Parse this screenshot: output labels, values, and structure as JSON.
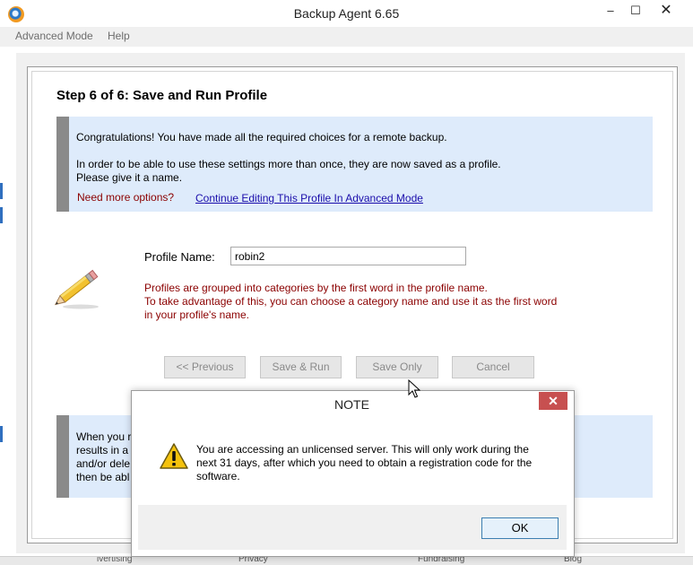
{
  "window": {
    "title": "Backup Agent 6.65",
    "minimize_glyph": "–",
    "maximize_glyph": "☐",
    "close_glyph": "✕"
  },
  "menu": {
    "items": [
      {
        "label": "Advanced Mode"
      },
      {
        "label": "Help"
      }
    ]
  },
  "wizard": {
    "step_title": "Step 6 of 6: Save and Run Profile",
    "congrats": "Congratulations! You have made all the required choices for a remote backup.",
    "save_line1": "In order to be able to use these settings more than once, they are now saved as a profile.",
    "save_line2": "Please give it a name.",
    "more_options": "Need more options?",
    "continue_link": "Continue Editing This Profile In Advanced Mode",
    "profile_label": "Profile Name:",
    "profile_value": "robin2",
    "hints": [
      "Profiles are grouped into categories by the first word in the profile name.",
      "To take advantage of this, you can choose a category name and use it as the first word",
      "in your profile's name."
    ],
    "buttons": {
      "previous": "<< Previous",
      "save_run": "Save & Run",
      "save_only": "Save Only",
      "cancel": "Cancel"
    },
    "info2_lines": [
      "When you r",
      "results in a l",
      "and/or dele",
      "then be abl"
    ]
  },
  "taskbar": {
    "items": [
      "ivertising",
      "Privacy",
      "Fundraising",
      "Blog"
    ]
  },
  "dialog": {
    "title": "NOTE",
    "close_glyph": "✕",
    "message": "You are accessing an unlicensed server. This will only work during the next 31 days, after which you need to obtain a registration code for the software.",
    "ok_label": "OK",
    "icon": "warning-icon"
  },
  "colors": {
    "info_bg": "#deebfb",
    "accent_bar": "#8a8a8a",
    "hint_red": "#8b0000",
    "link_blue": "#1a0dab",
    "close_red": "#c75050"
  }
}
